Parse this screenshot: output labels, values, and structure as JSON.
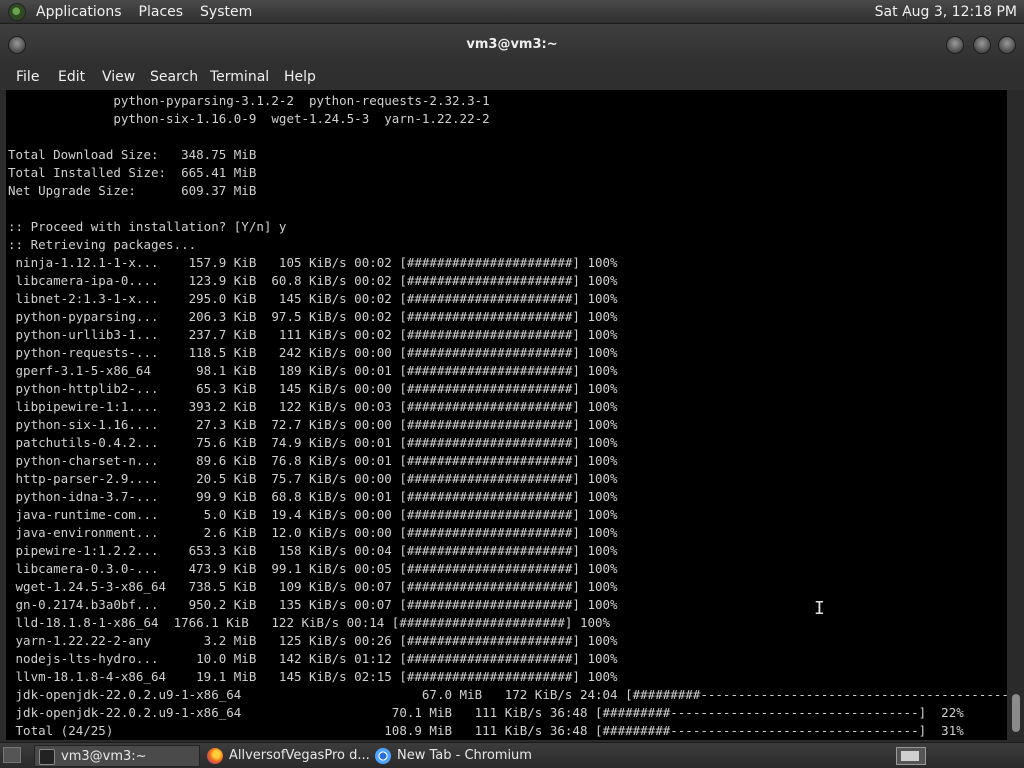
{
  "top_panel": {
    "menus": [
      "Applications",
      "Places",
      "System"
    ],
    "clock": "Sat Aug  3, 12:18 PM"
  },
  "window": {
    "title": "vm3@vm3:~",
    "menu": [
      "File",
      "Edit",
      "View",
      "Search",
      "Terminal",
      "Help"
    ]
  },
  "terminal": {
    "lines": [
      "              python-pyparsing-3.1.2-2  python-requests-2.32.3-1",
      "              python-six-1.16.0-9  wget-1.24.5-3  yarn-1.22.22-2",
      "",
      "Total Download Size:   348.75 MiB",
      "Total Installed Size:  665.41 MiB",
      "Net Upgrade Size:      609.37 MiB",
      "",
      ":: Proceed with installation? [Y/n] y",
      ":: Retrieving packages...",
      " ninja-1.12.1-1-x...    157.9 KiB   105 KiB/s 00:02 [######################] 100%",
      " libcamera-ipa-0....    123.9 KiB  60.8 KiB/s 00:02 [######################] 100%",
      " libnet-2:1.3-1-x...    295.0 KiB   145 KiB/s 00:02 [######################] 100%",
      " python-pyparsing...    206.3 KiB  97.5 KiB/s 00:02 [######################] 100%",
      " python-urllib3-1...    237.7 KiB   111 KiB/s 00:02 [######################] 100%",
      " python-requests-...    118.5 KiB   242 KiB/s 00:00 [######################] 100%",
      " gperf-3.1-5-x86_64      98.1 KiB   189 KiB/s 00:01 [######################] 100%",
      " python-httplib2-...     65.3 KiB   145 KiB/s 00:00 [######################] 100%",
      " libpipewire-1:1....    393.2 KiB   122 KiB/s 00:03 [######################] 100%",
      " python-six-1.16....     27.3 KiB  72.7 KiB/s 00:00 [######################] 100%",
      " patchutils-0.4.2...     75.6 KiB  74.9 KiB/s 00:01 [######################] 100%",
      " python-charset-n...     89.6 KiB  76.8 KiB/s 00:01 [######################] 100%",
      " http-parser-2.9....     20.5 KiB  75.7 KiB/s 00:00 [######################] 100%",
      " python-idna-3.7-...     99.9 KiB  68.8 KiB/s 00:01 [######################] 100%",
      " java-runtime-com...      5.0 KiB  19.4 KiB/s 00:00 [######################] 100%",
      " java-environment...      2.6 KiB  12.0 KiB/s 00:00 [######################] 100%",
      " pipewire-1:1.2.2...    653.3 KiB   158 KiB/s 00:04 [######################] 100%",
      " libcamera-0.3.0-...    473.9 KiB  99.1 KiB/s 00:05 [######################] 100%",
      " wget-1.24.5-3-x86_64   738.5 KiB   109 KiB/s 00:07 [######################] 100%",
      " gn-0.2174.b3a0bf...    950.2 KiB   135 KiB/s 00:07 [######################] 100%",
      " lld-18.1.8-1-x86_64  1766.1 KiB   122 KiB/s 00:14 [######################] 100%",
      " yarn-1.22.22-2-any       3.2 MiB   125 KiB/s 00:26 [######################] 100%",
      " nodejs-lts-hydro...     10.0 MiB   142 KiB/s 01:12 [######################] 100%",
      " llvm-18.1.8-4-x86_64    19.1 MiB   145 KiB/s 02:15 [######################] 100%",
      " jdk-openjdk-22.0.2.u9-1-x86_64                        67.0 MiB   172 KiB/s 24:04 [#########------------------------------------------",
      " jdk-openjdk-22.0.2.u9-1-x86_64                    70.1 MiB   111 KiB/s 36:48 [#########---------------------------------]  22%",
      " Total (24/25)                                    108.9 MiB   111 KiB/s 36:48 [#########---------------------------------]  31%"
    ]
  },
  "taskbar": {
    "tasks": [
      {
        "label": "vm3@vm3:~",
        "icon": "terminal-icon"
      },
      {
        "label": "AllversofVegasPro d...",
        "icon": "firefox-icon"
      },
      {
        "label": "New Tab - Chromium",
        "icon": "chromium-icon"
      }
    ]
  }
}
